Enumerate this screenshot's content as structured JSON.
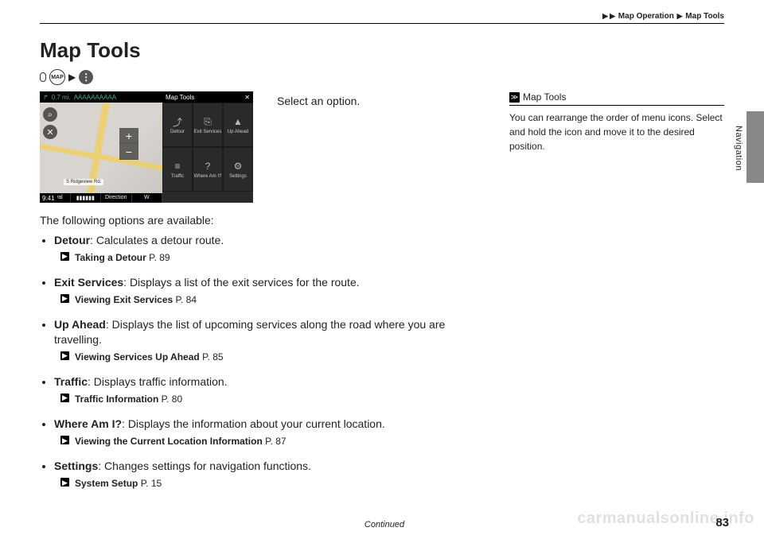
{
  "breadcrumb": {
    "a": "Map Operation",
    "b": "Map Tools"
  },
  "title": "Map Tools",
  "sideTab": "Navigation",
  "seq": {
    "map": "MAP"
  },
  "screenshot": {
    "dist": "0.7 mi.",
    "dest": "AAAAAAAAAA",
    "panelTitle": "Map Tools",
    "close": "✕",
    "clock": "9:41",
    "bl1": "Arrival",
    "bl2": "Direction",
    "dir": "W",
    "road": "S Ridgeview Rd.",
    "cells": [
      {
        "icon": "⤴",
        "label": "Detour"
      },
      {
        "icon": "⎘",
        "label": "Exit Services"
      },
      {
        "icon": "▲",
        "label": "Up Ahead"
      },
      {
        "icon": "≡",
        "label": "Traffic"
      },
      {
        "icon": "?",
        "label": "Where Am I?"
      },
      {
        "icon": "⚙",
        "label": "Settings"
      }
    ]
  },
  "instruction": "Select an option.",
  "intro": "The following options are available:",
  "options": [
    {
      "term": "Detour",
      "desc": ": Calculates a detour route.",
      "refTitle": "Taking a Detour",
      "refPage": " P. 89"
    },
    {
      "term": "Exit Services",
      "desc": ": Displays a list of the exit services for the route.",
      "refTitle": "Viewing Exit Services",
      "refPage": " P. 84"
    },
    {
      "term": "Up Ahead",
      "desc": ": Displays the list of upcoming services along the road where you are travelling.",
      "refTitle": "Viewing Services Up Ahead",
      "refPage": " P. 85"
    },
    {
      "term": "Traffic",
      "desc": ": Displays traffic information.",
      "refTitle": "Traffic Information",
      "refPage": " P. 80"
    },
    {
      "term": "Where Am I?",
      "desc": ": Displays the information about your current location.",
      "refTitle": "Viewing the Current Location Information",
      "refPage": " P. 87"
    },
    {
      "term": "Settings",
      "desc": ": Changes settings for navigation functions.",
      "refTitle": "System Setup",
      "refPage": " P. 15"
    }
  ],
  "sideNote": {
    "title": "Map Tools",
    "body": "You can rearrange the order of menu icons. Select and hold the icon and move it to the desired position."
  },
  "footer": {
    "continued": "Continued",
    "page": "83"
  },
  "watermark": "carmanualsonline.info"
}
